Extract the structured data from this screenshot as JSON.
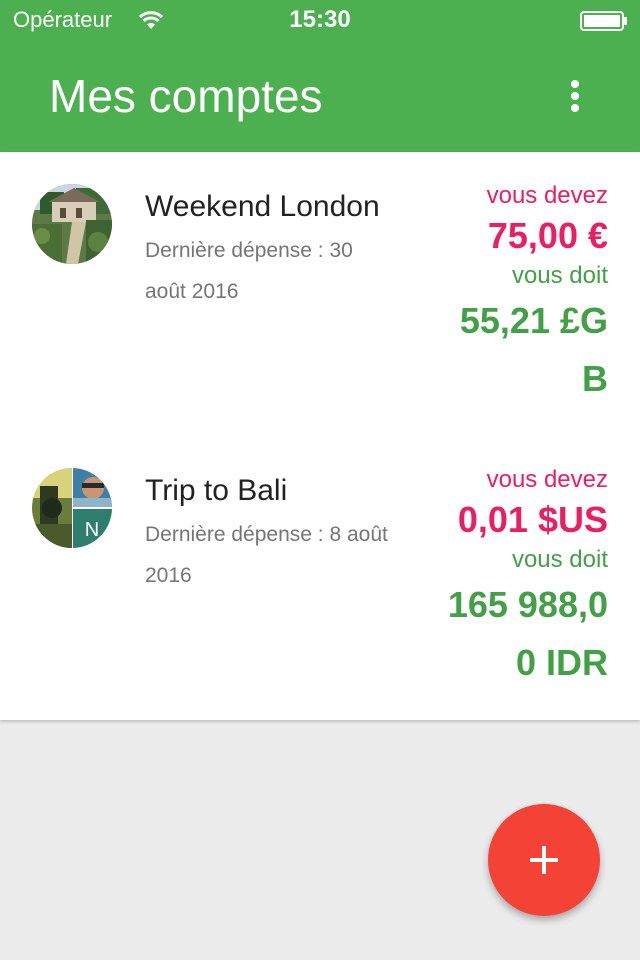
{
  "status_bar": {
    "carrier": "Opérateur",
    "time": "15:30"
  },
  "header": {
    "title": "Mes comptes",
    "menu_icon": "more-vert-icon"
  },
  "accounts": [
    {
      "name": "Weekend London",
      "last_expense": "Dernière dépense : 30 août 2016",
      "owe_label": "vous devez",
      "owe_amount": "75,00 €",
      "owed_label": "vous doit",
      "owed_amount": "55,21 £GB"
    },
    {
      "name": "Trip to Bali",
      "last_expense": "Dernière dépense : 8 août 2016",
      "owe_label": "vous devez",
      "owe_amount": "0,01 $US",
      "owed_label": "vous doit",
      "owed_amount": "165 988,00 IDR",
      "avatar_initial": "N"
    }
  ],
  "fab": {
    "icon": "plus-icon"
  },
  "colors": {
    "header": "#4caf50",
    "owe": "#e91e63",
    "owed": "#43a047",
    "fab": "#f44336"
  }
}
